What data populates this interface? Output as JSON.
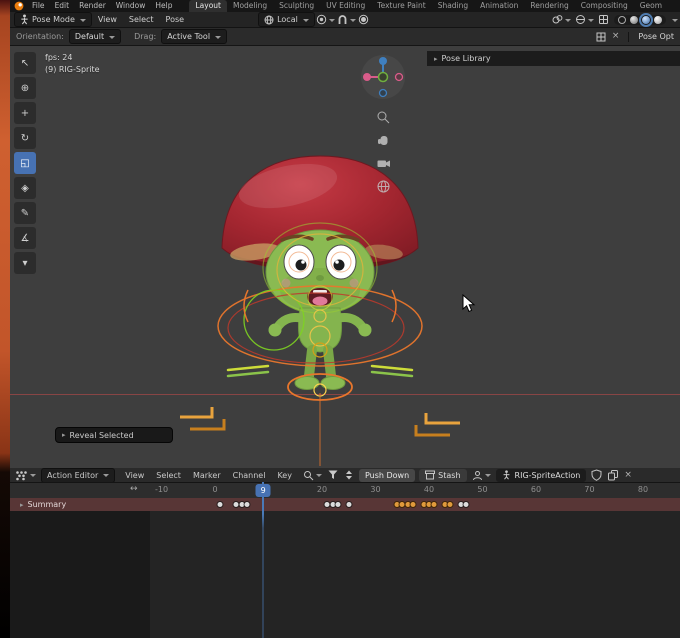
{
  "topbar": {
    "app_menus": [
      "File",
      "Edit",
      "Render",
      "Window",
      "Help"
    ],
    "workspace_tabs": [
      {
        "label": "Layout",
        "active": true
      },
      {
        "label": "Modeling"
      },
      {
        "label": "Sculpting"
      },
      {
        "label": "UV Editing"
      },
      {
        "label": "Texture Paint"
      },
      {
        "label": "Shading"
      },
      {
        "label": "Animation"
      },
      {
        "label": "Rendering"
      },
      {
        "label": "Compositing"
      },
      {
        "label": "Geom"
      }
    ]
  },
  "viewport_header": {
    "mode": "Pose Mode",
    "menus": [
      "View",
      "Select",
      "Pose"
    ],
    "transform_orientation": "Local"
  },
  "tool_settings": {
    "orientation_label": "Orientation:",
    "orientation_value": "Default",
    "drag_label": "Drag:",
    "drag_value": "Active Tool",
    "pose_options_label": "Pose Opt"
  },
  "sidebar": {
    "pose_library_label": "Pose Library"
  },
  "viewport": {
    "fps_text": "fps: 24",
    "active_object": "(9) RIG-Sprite",
    "reveal_panel_label": "Reveal Selected"
  },
  "toolbar": {
    "tools": [
      {
        "name": "select-tool",
        "glyph": "↖"
      },
      {
        "name": "cursor-tool",
        "glyph": "⊕"
      },
      {
        "name": "move-tool",
        "glyph": "+"
      },
      {
        "name": "rotate-tool",
        "glyph": "↻"
      },
      {
        "name": "scale-tool",
        "glyph": "◱",
        "active": true
      },
      {
        "name": "transform-tool",
        "glyph": "◈"
      },
      {
        "name": "annotate-tool",
        "glyph": "✎"
      },
      {
        "name": "measure-tool",
        "glyph": "∡"
      },
      {
        "name": "more-tools",
        "glyph": "▾"
      }
    ]
  },
  "dopesheet": {
    "editor_mode": "Action Editor",
    "menus": [
      "View",
      "Select",
      "Marker",
      "Channel",
      "Key"
    ],
    "push_down_label": "Push Down",
    "stash_label": "Stash",
    "action_name": "RIG-SpriteAction",
    "current_frame": 9,
    "ruler_ticks": [
      -10,
      0,
      20,
      30,
      40,
      50,
      60,
      70,
      80
    ],
    "channels": [
      {
        "name": "Summary"
      }
    ],
    "keyframes": [
      {
        "frame": 1
      },
      {
        "frame": 4
      },
      {
        "frame": 5
      },
      {
        "frame": 6
      },
      {
        "frame": 21
      },
      {
        "frame": 22
      },
      {
        "frame": 23
      },
      {
        "frame": 25
      },
      {
        "frame": 34,
        "selected": true
      },
      {
        "frame": 35,
        "selected": true
      },
      {
        "frame": 36,
        "selected": true
      },
      {
        "frame": 37,
        "selected": true
      },
      {
        "frame": 39,
        "selected": true
      },
      {
        "frame": 40,
        "selected": true
      },
      {
        "frame": 41,
        "selected": true
      },
      {
        "frame": 43,
        "selected": true
      },
      {
        "frame": 44,
        "selected": true
      },
      {
        "frame": 46
      },
      {
        "frame": 47
      }
    ]
  },
  "colors": {
    "accent_blue": "#4772b3",
    "keyframe_selected": "#e09a3c",
    "rig_orange": "#e8762c",
    "cap_red": "#a32630",
    "body_green": "#86b84e"
  }
}
